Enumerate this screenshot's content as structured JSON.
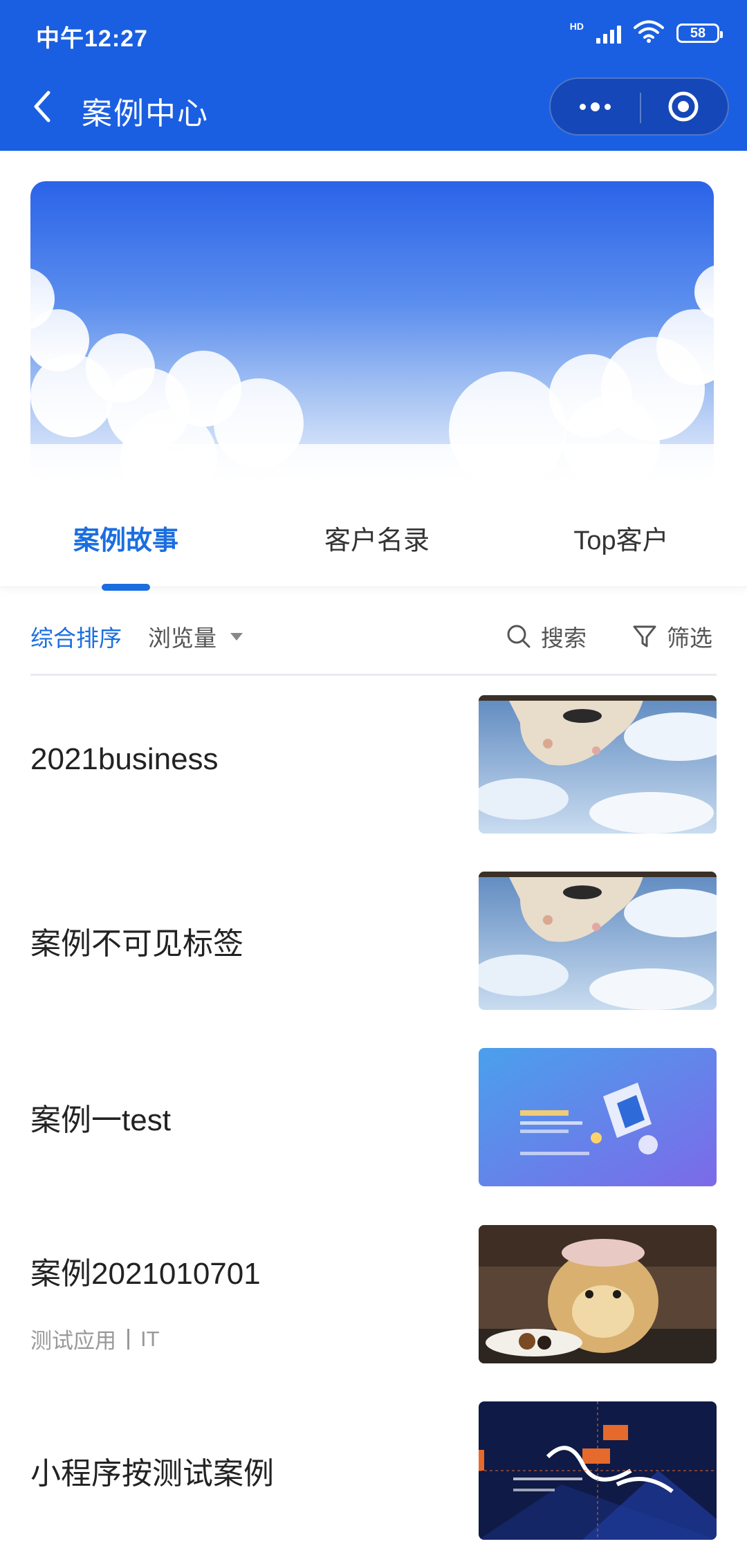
{
  "status_bar": {
    "time": "中午12:27",
    "network": "HD",
    "battery": "58"
  },
  "nav": {
    "title": "案例中心"
  },
  "tabs": [
    {
      "label": "案例故事",
      "active": true
    },
    {
      "label": "客户名录",
      "active": false
    },
    {
      "label": "Top客户",
      "active": false
    }
  ],
  "filters": {
    "sort_label": "综合排序",
    "views_label": "浏览量",
    "search_label": "搜索",
    "filter_label": "筛选"
  },
  "cases": [
    {
      "title": "2021business",
      "tags": [],
      "thumb": "plush-bear-clouds-photo"
    },
    {
      "title": "案例不可见标签",
      "tags": [],
      "thumb": "plush-bear-clouds-photo"
    },
    {
      "title": "案例一test",
      "tags": [],
      "thumb": "cloud-service-promo-banner"
    },
    {
      "title": "案例2021010701",
      "tags": [
        "测试应用",
        "IT"
      ],
      "thumb": "winnie-plush-photo"
    },
    {
      "title": "小程序按测试案例",
      "tags": [],
      "thumb": "tencent-promo-banner"
    }
  ],
  "colors": {
    "header": "#1a5fe2",
    "accent": "#1a6ee0"
  }
}
